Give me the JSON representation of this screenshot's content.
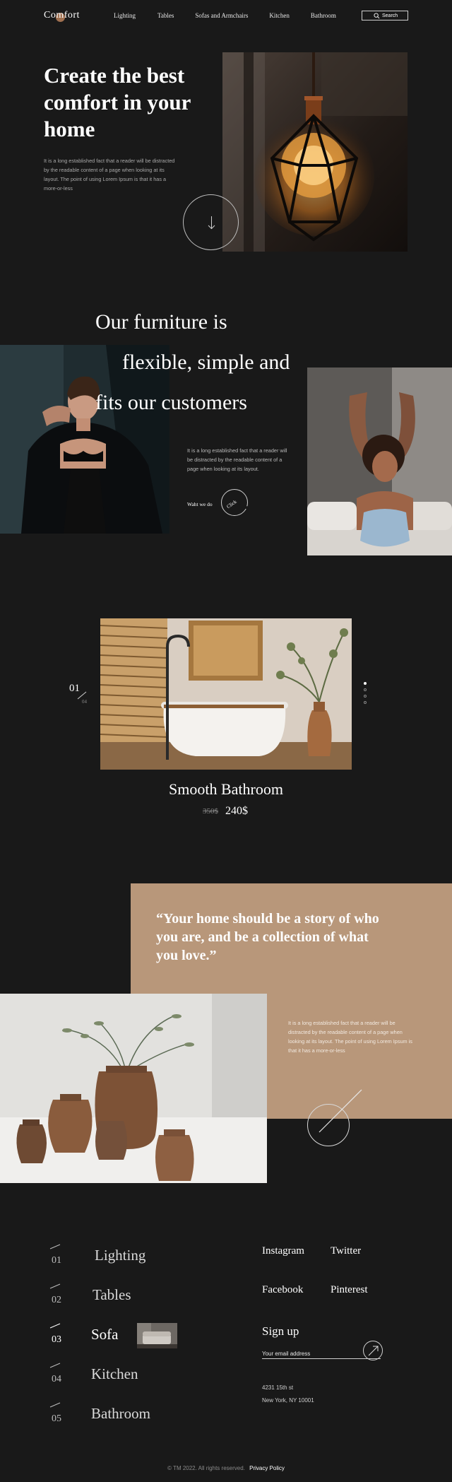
{
  "brand": {
    "logo": "Comfort",
    "accent": "#b9805a"
  },
  "nav": {
    "items": [
      "Lighting",
      "Tables",
      "Sofas and Armchairs",
      "Kitchen",
      "Bathroom"
    ],
    "search_placeholder": "Search"
  },
  "hero": {
    "title": "Create the best comfort in your home",
    "text": "It is a long established fact that a reader will be distracted by the readable content of a page when looking at its layout. The point of using Lorem Ipsum is that it has a more-or-less",
    "scroll_icon": "arrow-down-icon"
  },
  "about": {
    "line1": "Our furniture is",
    "line2": "flexible, simple and",
    "line3": "fits our customers",
    "text": "It is a long established fact that a reader will be distracted by the readable content of a page when looking at its layout.",
    "link": "Waht we do",
    "circle_label": "Click"
  },
  "slider": {
    "current": "01",
    "total": "04",
    "title": "Smooth Bathroom",
    "old_price": "350$",
    "new_price": "240$",
    "dot_count": 4,
    "active_dot": 0
  },
  "quote": {
    "text": "“Your home should be a story of who you are, and be a collection of what you love.”",
    "text_body": "It is a long established fact that a reader will be distracted by the readable content of a page when looking at its layout. The point of using Lorem Ipsum is that it has a more-or-less",
    "bg_color": "#b8977a"
  },
  "footer": {
    "categories": [
      {
        "num": "01",
        "label": "Lighting"
      },
      {
        "num": "02",
        "label": "Tables"
      },
      {
        "num": "03",
        "label": "Sofa"
      },
      {
        "num": "04",
        "label": "Kitchen"
      },
      {
        "num": "05",
        "label": "Bathroom"
      }
    ],
    "social": [
      "Instagram",
      "Twitter",
      "Facebook",
      "Pinterest"
    ],
    "signup": "Sign up",
    "email_placeholder": "Your email address",
    "address_line1": "4231 15th st",
    "address_line2": "New York, NY 10001",
    "copyright": "© TM 2022. All rights reserved.",
    "policy": "Privacy Policy"
  }
}
